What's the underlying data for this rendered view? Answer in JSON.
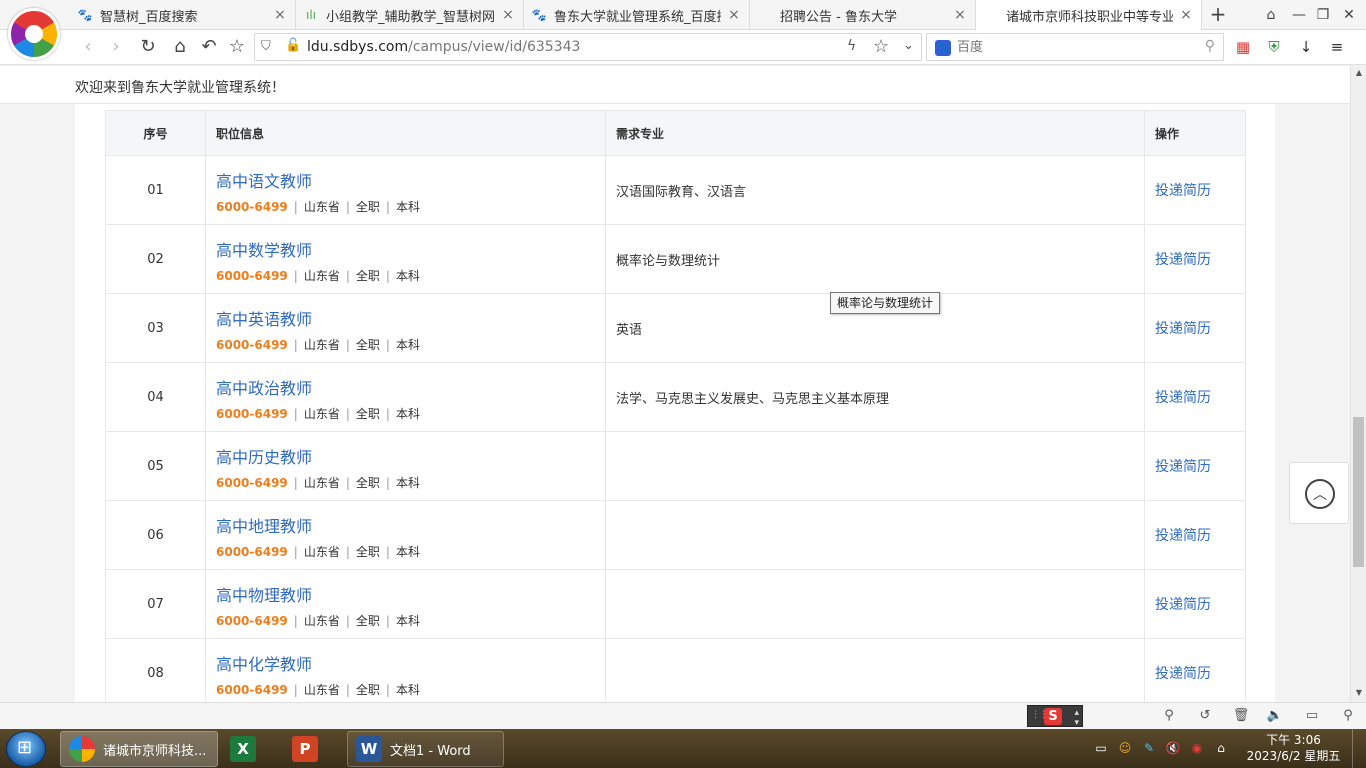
{
  "browser": {
    "tabs": [
      {
        "label": "智慧树_百度搜索",
        "icon": "baidu-paw-icon",
        "active": false
      },
      {
        "label": "小组教学_辅助教学_智慧树网",
        "icon": "bars-icon",
        "active": false
      },
      {
        "label": "鲁东大学就业管理系统_百度搜索",
        "icon": "baidu-paw-icon",
        "active": false
      },
      {
        "label": "招聘公告 - 鲁东大学",
        "icon": "",
        "active": false
      },
      {
        "label": "诸城市京师科技职业中等专业学",
        "icon": "",
        "active": true
      }
    ],
    "new_tab": "+",
    "url_host": "ldu.sdbys.com",
    "url_path": "/campus/view/id/635343",
    "search_placeholder": "百度"
  },
  "page": {
    "welcome": "欢迎来到鲁东大学就业管理系统！",
    "columns": {
      "no": "序号",
      "position": "职位信息",
      "major": "需求专业",
      "action": "操作"
    },
    "rows": [
      {
        "no": "01",
        "title": "高中语文教师",
        "salary": "6000-6499",
        "location": "山东省",
        "type": "全职",
        "degree": "本科",
        "major": "汉语国际教育、汉语言",
        "action": "投递简历"
      },
      {
        "no": "02",
        "title": "高中数学教师",
        "salary": "6000-6499",
        "location": "山东省",
        "type": "全职",
        "degree": "本科",
        "major": "概率论与数理统计",
        "action": "投递简历"
      },
      {
        "no": "03",
        "title": "高中英语教师",
        "salary": "6000-6499",
        "location": "山东省",
        "type": "全职",
        "degree": "本科",
        "major": "英语",
        "action": "投递简历"
      },
      {
        "no": "04",
        "title": "高中政治教师",
        "salary": "6000-6499",
        "location": "山东省",
        "type": "全职",
        "degree": "本科",
        "major": "法学、马克思主义发展史、马克思主义基本原理",
        "action": "投递简历"
      },
      {
        "no": "05",
        "title": "高中历史教师",
        "salary": "6000-6499",
        "location": "山东省",
        "type": "全职",
        "degree": "本科",
        "major": "",
        "action": "投递简历"
      },
      {
        "no": "06",
        "title": "高中地理教师",
        "salary": "6000-6499",
        "location": "山东省",
        "type": "全职",
        "degree": "本科",
        "major": "",
        "action": "投递简历"
      },
      {
        "no": "07",
        "title": "高中物理教师",
        "salary": "6000-6499",
        "location": "山东省",
        "type": "全职",
        "degree": "本科",
        "major": "",
        "action": "投递简历"
      },
      {
        "no": "08",
        "title": "高中化学教师",
        "salary": "6000-6499",
        "location": "山东省",
        "type": "全职",
        "degree": "本科",
        "major": "",
        "action": "投递简历"
      }
    ],
    "tooltip": "概率论与数理统计"
  },
  "taskbar": {
    "tasks": [
      {
        "label": "诸城市京师科技...",
        "icon": "browser-icon",
        "active": true
      },
      {
        "label": "",
        "icon": "excel-icon",
        "glyph": "X"
      },
      {
        "label": "",
        "icon": "powerpoint-icon",
        "glyph": "P"
      },
      {
        "label": "文档1 - Word",
        "icon": "word-icon",
        "glyph": "W"
      }
    ],
    "clock_time": "下午 3:06",
    "clock_date": "2023/6/2 星期五"
  },
  "colors": {
    "link": "#2f6bbf",
    "salary": "#f07c1a",
    "header_bg": "#f4f6fa"
  }
}
